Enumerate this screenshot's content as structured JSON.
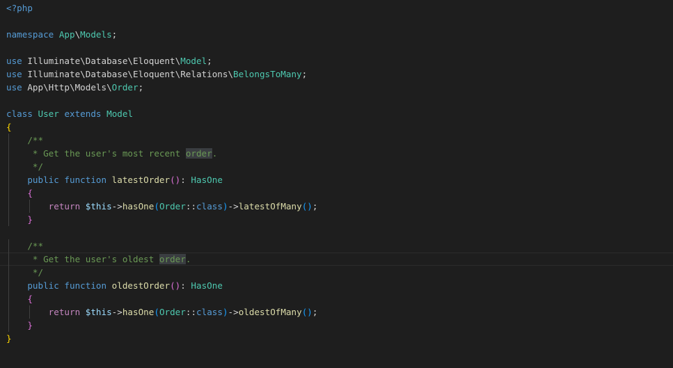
{
  "editor": {
    "language": "php",
    "theme_colors": {
      "background": "#1e1e1e",
      "plain": "#d4d4d4",
      "keyword": "#569cd6",
      "type": "#4ec9b0",
      "function": "#dcdcaa",
      "variable": "#9cdcfe",
      "comment": "#6a9955",
      "control": "#c586c0",
      "bracket_gold": "#ffd700",
      "bracket_orchid": "#da70d6",
      "bracket_blue": "#179fff",
      "highlight": "#3a3d41"
    },
    "lines": [
      {
        "tokens": [
          {
            "t": "<?php",
            "c": "tag"
          }
        ]
      },
      {
        "tokens": []
      },
      {
        "tokens": [
          {
            "t": "namespace ",
            "c": "kw"
          },
          {
            "t": "App",
            "c": "type"
          },
          {
            "t": "\\",
            "c": "plain"
          },
          {
            "t": "Models",
            "c": "type"
          },
          {
            "t": ";",
            "c": "plain"
          }
        ]
      },
      {
        "tokens": []
      },
      {
        "tokens": [
          {
            "t": "use ",
            "c": "kw"
          },
          {
            "t": "Illuminate\\Database\\Eloquent\\",
            "c": "plain"
          },
          {
            "t": "Model",
            "c": "type"
          },
          {
            "t": ";",
            "c": "plain"
          }
        ]
      },
      {
        "tokens": [
          {
            "t": "use ",
            "c": "kw"
          },
          {
            "t": "Illuminate\\Database\\Eloquent\\Relations\\",
            "c": "plain"
          },
          {
            "t": "BelongsToMany",
            "c": "type"
          },
          {
            "t": ";",
            "c": "plain"
          }
        ]
      },
      {
        "tokens": [
          {
            "t": "use ",
            "c": "kw"
          },
          {
            "t": "App\\Http\\Models\\",
            "c": "plain"
          },
          {
            "t": "Order",
            "c": "type"
          },
          {
            "t": ";",
            "c": "plain"
          }
        ]
      },
      {
        "tokens": []
      },
      {
        "tokens": [
          {
            "t": "class ",
            "c": "kw"
          },
          {
            "t": "User",
            "c": "type"
          },
          {
            "t": " ",
            "c": "plain"
          },
          {
            "t": "extends",
            "c": "kw"
          },
          {
            "t": " ",
            "c": "plain"
          },
          {
            "t": "Model",
            "c": "type"
          }
        ]
      },
      {
        "tokens": [
          {
            "t": "{",
            "c": "b1"
          }
        ]
      },
      {
        "indent": 1,
        "tokens": [
          {
            "t": "/**",
            "c": "cmt"
          }
        ]
      },
      {
        "indent": 1,
        "tokens": [
          {
            "t": " * Get the user's most recent ",
            "c": "cmt"
          },
          {
            "t": "order",
            "c": "hl"
          },
          {
            "t": ".",
            "c": "cmt"
          }
        ]
      },
      {
        "indent": 1,
        "tokens": [
          {
            "t": " */",
            "c": "cmt"
          }
        ]
      },
      {
        "indent": 1,
        "tokens": [
          {
            "t": "public ",
            "c": "kw"
          },
          {
            "t": "function ",
            "c": "kw"
          },
          {
            "t": "latestOrder",
            "c": "fn"
          },
          {
            "t": "()",
            "c": "b2"
          },
          {
            "t": ": ",
            "c": "plain"
          },
          {
            "t": "HasOne",
            "c": "type"
          }
        ]
      },
      {
        "indent": 1,
        "tokens": [
          {
            "t": "{",
            "c": "b2"
          }
        ]
      },
      {
        "indent": 2,
        "tokens": [
          {
            "t": "return ",
            "c": "kw2"
          },
          {
            "t": "$this",
            "c": "var"
          },
          {
            "t": "->",
            "c": "plain"
          },
          {
            "t": "hasOne",
            "c": "fn"
          },
          {
            "t": "(",
            "c": "b3"
          },
          {
            "t": "Order",
            "c": "type"
          },
          {
            "t": "::",
            "c": "plain"
          },
          {
            "t": "class",
            "c": "kw"
          },
          {
            "t": ")",
            "c": "b3"
          },
          {
            "t": "->",
            "c": "plain"
          },
          {
            "t": "latestOfMany",
            "c": "fn"
          },
          {
            "t": "()",
            "c": "b3"
          },
          {
            "t": ";",
            "c": "plain"
          }
        ]
      },
      {
        "indent": 1,
        "tokens": [
          {
            "t": "}",
            "c": "b2"
          }
        ]
      },
      {
        "tokens": []
      },
      {
        "indent": 1,
        "tokens": [
          {
            "t": "/**",
            "c": "cmt"
          }
        ]
      },
      {
        "indent": 1,
        "current": true,
        "tokens": [
          {
            "t": " * Get the user's oldest ",
            "c": "cmt"
          },
          {
            "t": "order",
            "c": "hl"
          },
          {
            "t": ".",
            "c": "cmt"
          }
        ]
      },
      {
        "indent": 1,
        "tokens": [
          {
            "t": " */",
            "c": "cmt"
          }
        ]
      },
      {
        "indent": 1,
        "tokens": [
          {
            "t": "public ",
            "c": "kw"
          },
          {
            "t": "function ",
            "c": "kw"
          },
          {
            "t": "oldestOrder",
            "c": "fn"
          },
          {
            "t": "()",
            "c": "b2"
          },
          {
            "t": ": ",
            "c": "plain"
          },
          {
            "t": "HasOne",
            "c": "type"
          }
        ]
      },
      {
        "indent": 1,
        "tokens": [
          {
            "t": "{",
            "c": "b2"
          }
        ]
      },
      {
        "indent": 2,
        "tokens": [
          {
            "t": "return ",
            "c": "kw2"
          },
          {
            "t": "$this",
            "c": "var"
          },
          {
            "t": "->",
            "c": "plain"
          },
          {
            "t": "hasOne",
            "c": "fn"
          },
          {
            "t": "(",
            "c": "b3"
          },
          {
            "t": "Order",
            "c": "type"
          },
          {
            "t": "::",
            "c": "plain"
          },
          {
            "t": "class",
            "c": "kw"
          },
          {
            "t": ")",
            "c": "b3"
          },
          {
            "t": "->",
            "c": "plain"
          },
          {
            "t": "oldestOfMany",
            "c": "fn"
          },
          {
            "t": "()",
            "c": "b3"
          },
          {
            "t": ";",
            "c": "plain"
          }
        ]
      },
      {
        "indent": 1,
        "tokens": [
          {
            "t": "}",
            "c": "b2"
          }
        ]
      },
      {
        "tokens": [
          {
            "t": "}",
            "c": "b1"
          }
        ]
      }
    ]
  }
}
